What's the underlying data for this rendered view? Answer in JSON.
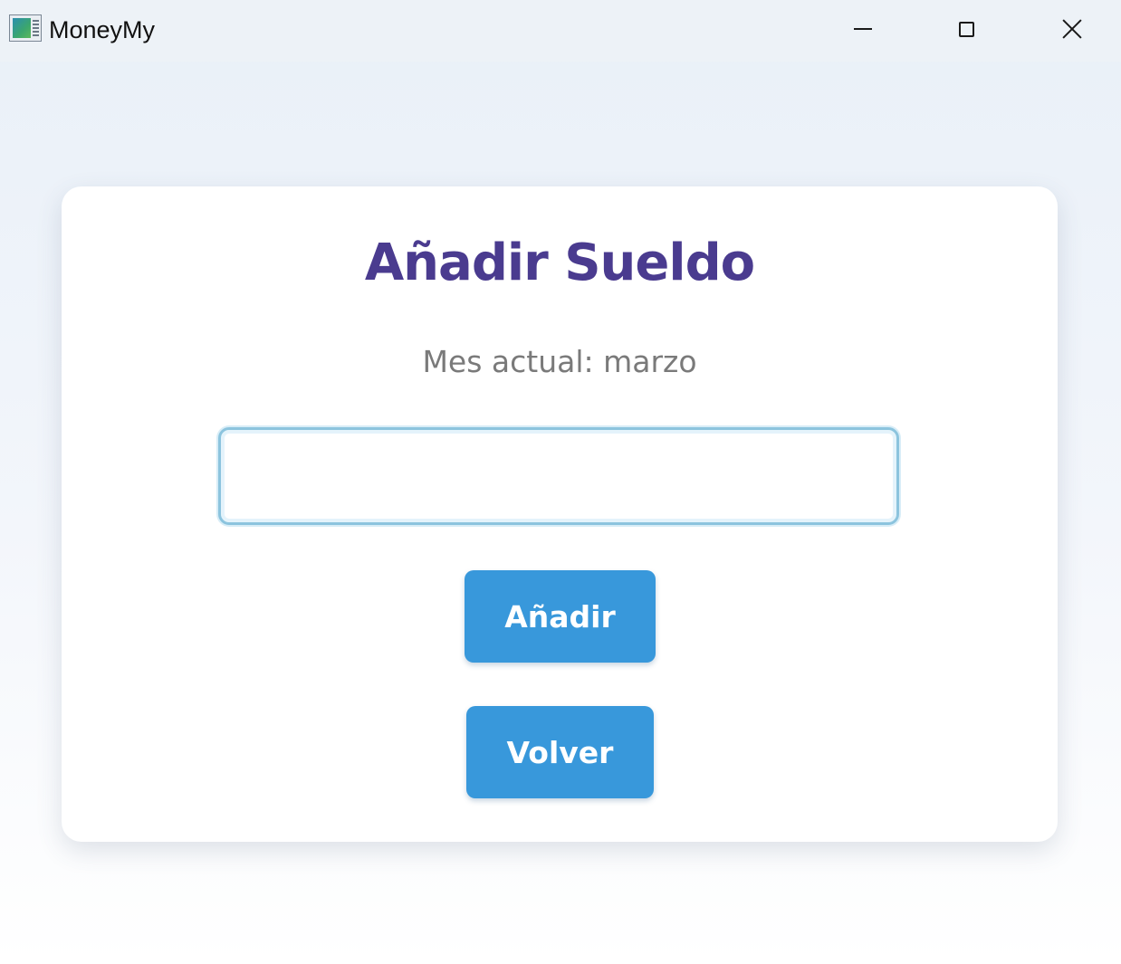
{
  "window": {
    "title": "MoneyMy",
    "icon": "app-chart-icon"
  },
  "controls": {
    "minimize_icon": "minimize-icon",
    "maximize_icon": "maximize-icon",
    "close_icon": "close-icon"
  },
  "card": {
    "title": "Añadir Sueldo",
    "subtitle": "Mes actual: marzo",
    "input": {
      "value": "",
      "placeholder": ""
    },
    "add_label": "Añadir",
    "back_label": "Volver"
  },
  "colors": {
    "title": "#4a3b8f",
    "button": "#3898db",
    "subtitle": "#7a7a7a"
  }
}
